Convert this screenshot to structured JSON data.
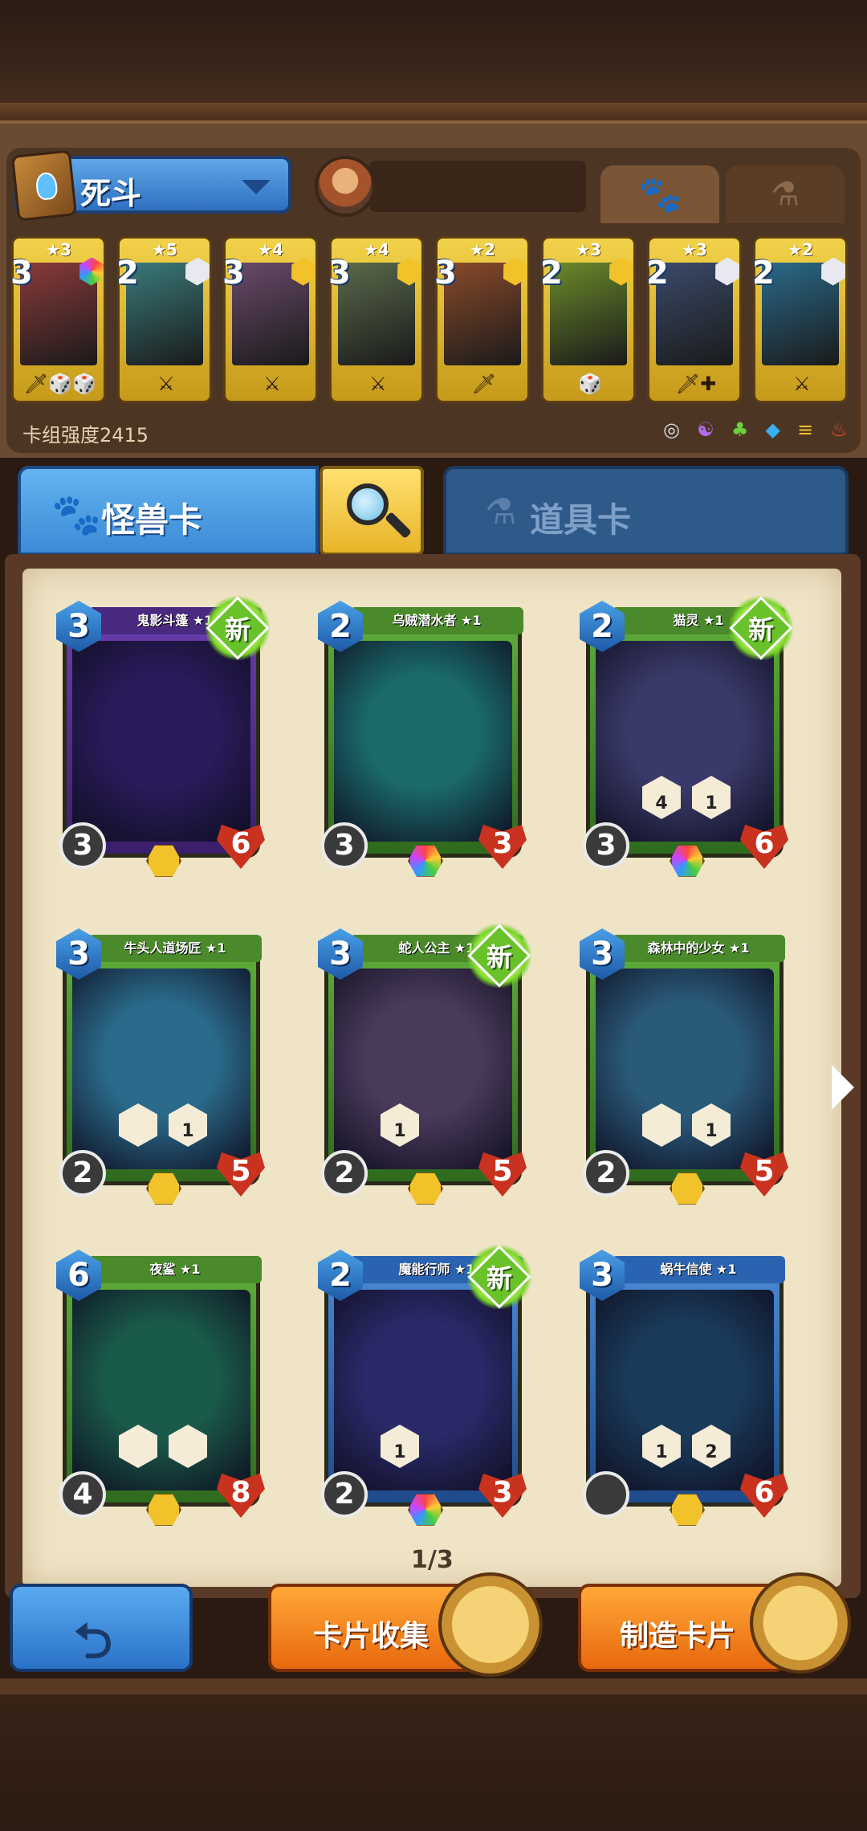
{
  "header": {
    "deck_name": "死斗",
    "deck_strength_label": "卡组强度2415"
  },
  "deck_cards": [
    {
      "stars": "★3",
      "cost": "3",
      "element": "rainbow",
      "foot": "🗡🎲🎲",
      "art": "#8a3a3a"
    },
    {
      "stars": "★5",
      "cost": "2",
      "element": "silver",
      "foot": "⚔",
      "art": "#3a7a7a"
    },
    {
      "stars": "★4",
      "cost": "3",
      "element": "gold",
      "foot": "⚔",
      "art": "#6a4a6a"
    },
    {
      "stars": "★4",
      "cost": "3",
      "element": "gold",
      "foot": "⚔",
      "art": "#5a6a4a"
    },
    {
      "stars": "★2",
      "cost": "3",
      "element": "gold",
      "foot": "🗡",
      "art": "#8a4a2a"
    },
    {
      "stars": "★3",
      "cost": "2",
      "element": "gold",
      "foot": "🎲",
      "art": "#6a8a2a"
    },
    {
      "stars": "★3",
      "cost": "2",
      "element": "silver",
      "foot": "🗡✚",
      "art": "#3a4a6a"
    },
    {
      "stars": "★2",
      "cost": "2",
      "element": "silver",
      "foot": "⚔",
      "art": "#2a6a8a"
    }
  ],
  "type_filters": [
    "◎",
    "☯",
    "♣",
    "◆",
    "≡",
    "♨"
  ],
  "tabs": {
    "monster_label": "怪兽卡",
    "items_label": "道具卡"
  },
  "collection": {
    "page_indicator": "1/3",
    "cards": [
      {
        "name": "鬼影斗篷 ★1",
        "cost": "3",
        "attack": "3",
        "health": "6",
        "color": "purple",
        "new": true,
        "rarity": "gold",
        "abilities": [],
        "art": "#2a1a5a"
      },
      {
        "name": "乌贼潜水者 ★1",
        "cost": "2",
        "attack": "3",
        "health": "3",
        "color": "green",
        "new": false,
        "rarity": "rainbow",
        "abilities": [],
        "art": "#1a6a6a"
      },
      {
        "name": "猫灵 ★1",
        "cost": "2",
        "attack": "3",
        "health": "6",
        "color": "green",
        "new": true,
        "rarity": "rainbow",
        "abilities": [
          "4",
          "1"
        ],
        "art": "#3a3a6a"
      },
      {
        "name": "牛头人道场匠 ★1",
        "cost": "3",
        "attack": "2",
        "health": "5",
        "color": "green",
        "new": false,
        "rarity": "gold",
        "abilities": [
          "",
          "1"
        ],
        "art": "#2a6a8a"
      },
      {
        "name": "蛇人公主 ★1",
        "cost": "3",
        "attack": "2",
        "health": "5",
        "color": "green",
        "new": true,
        "rarity": "gold",
        "abilities": [
          "1"
        ],
        "art": "#4a3a5a"
      },
      {
        "name": "森林中的少女 ★1",
        "cost": "3",
        "attack": "2",
        "health": "5",
        "color": "green",
        "new": false,
        "rarity": "gold",
        "abilities": [
          "",
          "1"
        ],
        "art": "#2a5a7a"
      },
      {
        "name": "夜鲨 ★1",
        "cost": "6",
        "attack": "4",
        "health": "8",
        "color": "green",
        "new": false,
        "rarity": "gold",
        "abilities": [
          "",
          ""
        ],
        "art": "#1a5a4a"
      },
      {
        "name": "魔能行师 ★1",
        "cost": "2",
        "attack": "2",
        "health": "3",
        "color": "blue",
        "new": true,
        "rarity": "rainbow",
        "abilities": [
          "1"
        ],
        "art": "#2a2a6a"
      },
      {
        "name": "蜗牛信使 ★1",
        "cost": "3",
        "attack": "",
        "health": "6",
        "color": "blue",
        "new": false,
        "rarity": "gold",
        "abilities": [
          "1",
          "2"
        ],
        "art": "#1a3a5a"
      }
    ]
  },
  "buttons": {
    "collect_label": "卡片收集",
    "craft_label": "制造卡片"
  }
}
